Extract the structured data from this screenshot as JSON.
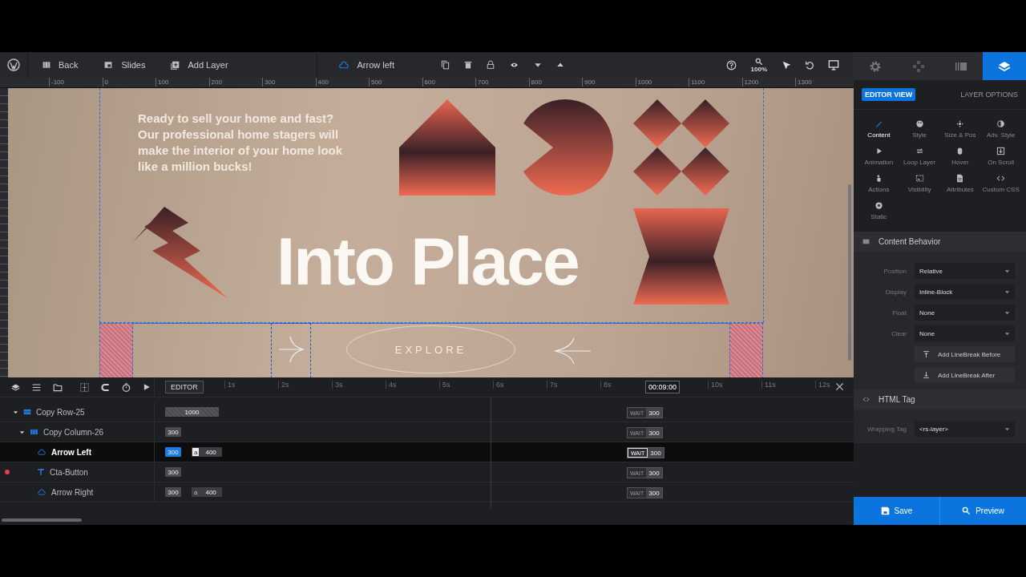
{
  "toolbar": {
    "items": [
      {
        "label": "Back"
      },
      {
        "label": "Slides"
      },
      {
        "label": "Add Layer"
      }
    ],
    "layer_name": "Arrow left",
    "zoom": "100%"
  },
  "panel_tabs": [
    {
      "kind": "settings",
      "selected": false
    },
    {
      "kind": "navigation",
      "selected": false
    },
    {
      "kind": "slides",
      "selected": false
    },
    {
      "kind": "layers",
      "selected": true
    }
  ],
  "ruler": {
    "ticks": [
      "-100",
      "0",
      "100",
      "200",
      "300",
      "400",
      "500",
      "600",
      "700",
      "800",
      "900",
      "1000",
      "1100",
      "1200",
      "1300"
    ]
  },
  "slide": {
    "intro_text": "Ready to sell your home and fast? Our professional home stagers will make the interior of your home look like a million bucks!",
    "headline": "Into Place",
    "cta": "EXPLORE"
  },
  "timeline": {
    "mode_label": "EDITOR",
    "time_marks": [
      "1s",
      "2s",
      "3s",
      "4s",
      "5s",
      "6s",
      "7s",
      "8s",
      "10s",
      "11s",
      "12s"
    ],
    "current_time": "00:09:00",
    "layers": [
      {
        "name": "Copy Row-25",
        "kind": "row",
        "expanded": true,
        "selected": false,
        "flagged": false,
        "start": "1000",
        "wait": "WAIT",
        "wait_value": "300",
        "children": [
          {
            "name": "Copy Column-26",
            "kind": "column",
            "expanded": true,
            "selected": false,
            "flagged": false,
            "start": "300",
            "wait": "WAIT",
            "wait_value": "300",
            "children": [
              {
                "name": "Arrow Left",
                "kind": "image",
                "selected": true,
                "flagged": false,
                "start": "300",
                "loop_label": "a",
                "loop_value": "400",
                "wait": "WAIT",
                "wait_value": "300"
              },
              {
                "name": "Cta-Button",
                "kind": "text",
                "selected": false,
                "flagged": true,
                "start": "300",
                "wait": "WAIT",
                "wait_value": "300"
              },
              {
                "name": "Arrow Right",
                "kind": "image",
                "selected": false,
                "flagged": false,
                "start": "300",
                "loop_label": "a",
                "loop_value": "400",
                "wait": "WAIT",
                "wait_value": "300"
              }
            ]
          }
        ]
      }
    ]
  },
  "panel": {
    "view_badge": "EDITOR VIEW",
    "title": "LAYER OPTIONS",
    "options": [
      {
        "label": "Content",
        "selected": true
      },
      {
        "label": "Style",
        "selected": false
      },
      {
        "label": "Size & Pos",
        "selected": false
      },
      {
        "label": "Adv. Style",
        "selected": false
      },
      {
        "label": "Animation",
        "selected": false
      },
      {
        "label": "Loop Layer",
        "selected": false
      },
      {
        "label": "Hover",
        "selected": false
      },
      {
        "label": "On Scroll",
        "selected": false
      },
      {
        "label": "Actions",
        "selected": false
      },
      {
        "label": "Visibility",
        "selected": false
      },
      {
        "label": "Attributes",
        "selected": false
      },
      {
        "label": "Custom CSS",
        "selected": false
      },
      {
        "label": "Static",
        "selected": false
      }
    ],
    "sections": [
      {
        "title": "Content Behavior",
        "fields": [
          {
            "label": "Position",
            "value": "Relative"
          },
          {
            "label": "Display",
            "value": "Inline-Block"
          },
          {
            "label": "Float",
            "value": "None"
          },
          {
            "label": "Clear",
            "value": "None"
          }
        ],
        "buttons": [
          "Add LineBreak Before",
          "Add LineBreak After"
        ]
      },
      {
        "title": "HTML Tag",
        "fields": [
          {
            "label": "Wrapping Tag",
            "value": "<rs-layer>"
          }
        ]
      }
    ],
    "footer": [
      "Save",
      "Preview"
    ]
  }
}
